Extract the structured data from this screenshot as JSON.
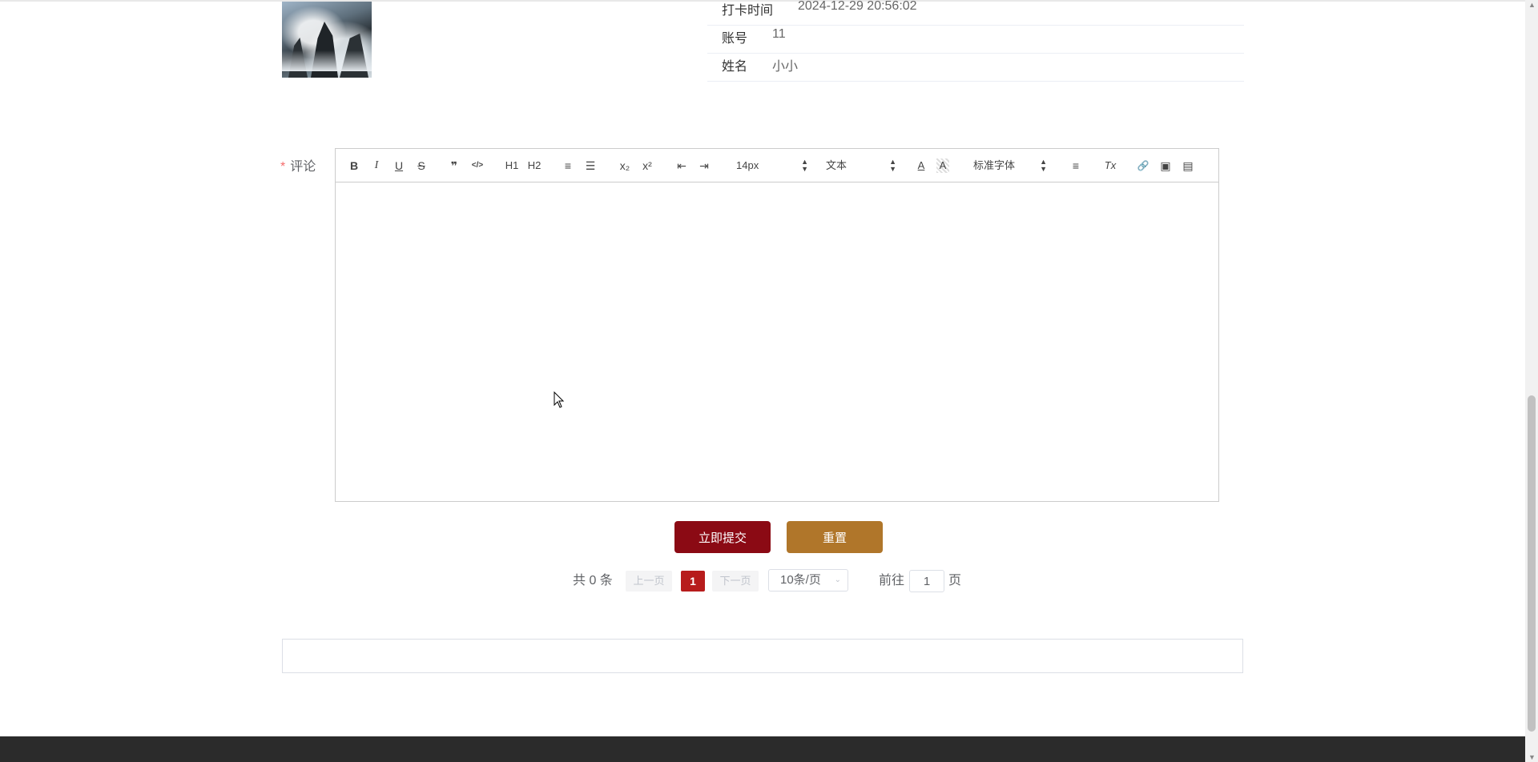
{
  "info": {
    "rows": [
      {
        "label": "打卡时间",
        "value": "2024-12-29 20:56:02"
      },
      {
        "label": "账号",
        "value": "11"
      },
      {
        "label": "姓名",
        "value": "小小"
      }
    ]
  },
  "comment": {
    "required_mark": "*",
    "label": "评论"
  },
  "toolbar": {
    "bold": "B",
    "italic": "I",
    "underline": "U",
    "strike": "S",
    "blockquote": "❞",
    "code": "</>",
    "h1": "H1",
    "h2": "H2",
    "ordered_list": "≡",
    "bullet_list": "☰",
    "subscript": "x₂",
    "superscript": "x²",
    "indent_out": "⇤",
    "indent_in": "⇥",
    "size_value": "14px",
    "header_value": "文本",
    "color": "A",
    "background": "A",
    "font_value": "标准字体",
    "align": "≡",
    "clean": "Tx",
    "link": "🔗",
    "image": "▣",
    "video": "▤"
  },
  "actions": {
    "submit_label": "立即提交",
    "reset_label": "重置"
  },
  "pagination": {
    "total_text": "共 0 条",
    "prev_label": "上一页",
    "current_page": "1",
    "next_label": "下一页",
    "page_size": "10条/页",
    "goto_label": "前往",
    "goto_value": "1",
    "page_suffix": "页"
  },
  "colors": {
    "submit": "#8b0a14",
    "reset": "#b0762a",
    "active_page": "#b71c1c",
    "footer": "#2b2b2b"
  }
}
